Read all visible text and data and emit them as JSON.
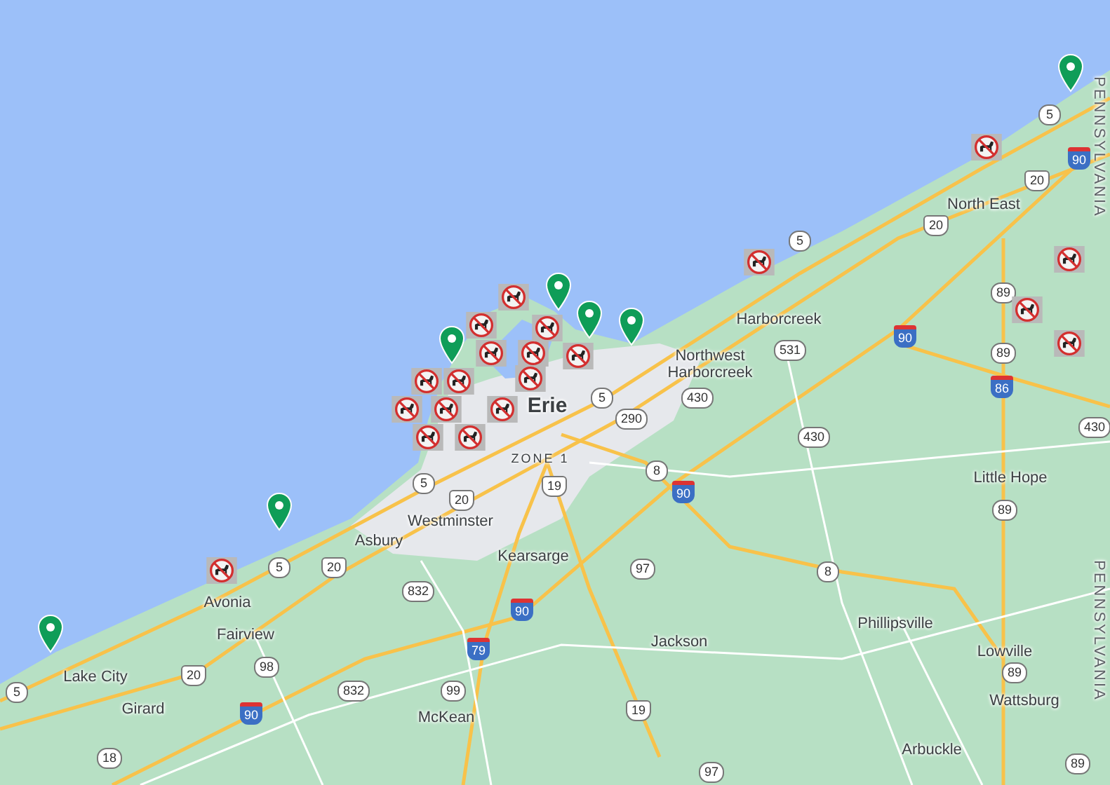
{
  "map": {
    "places": [
      {
        "label": "North East",
        "kind": "town"
      },
      {
        "label": "Harborcreek",
        "kind": "town"
      },
      {
        "label": "Northwest Harborcreek",
        "kind": "town"
      },
      {
        "label": "Erie",
        "kind": "city"
      },
      {
        "label": "ZONE 1",
        "kind": "district"
      },
      {
        "label": "Little Hope",
        "kind": "town"
      },
      {
        "label": "Westminster",
        "kind": "town"
      },
      {
        "label": "Asbury",
        "kind": "town"
      },
      {
        "label": "Kearsarge",
        "kind": "town"
      },
      {
        "label": "Avonia",
        "kind": "town"
      },
      {
        "label": "Fairview",
        "kind": "town"
      },
      {
        "label": "Jackson",
        "kind": "town"
      },
      {
        "label": "Phillipsville",
        "kind": "town"
      },
      {
        "label": "Lowville",
        "kind": "town"
      },
      {
        "label": "Lake City",
        "kind": "town"
      },
      {
        "label": "Girard",
        "kind": "town"
      },
      {
        "label": "Wattsburg",
        "kind": "town"
      },
      {
        "label": "McKean",
        "kind": "town"
      },
      {
        "label": "Arbuckle",
        "kind": "town"
      },
      {
        "label": "PENNSYLVANIA",
        "kind": "state"
      },
      {
        "label": "PENNSYLVANIA",
        "kind": "state"
      }
    ],
    "shields": [
      {
        "number": "5",
        "kind": "state"
      },
      {
        "number": "90",
        "kind": "interstate"
      },
      {
        "number": "20",
        "kind": "us"
      },
      {
        "number": "5",
        "kind": "state"
      },
      {
        "number": "20",
        "kind": "us"
      },
      {
        "number": "89",
        "kind": "state"
      },
      {
        "number": "531",
        "kind": "state"
      },
      {
        "number": "90",
        "kind": "interstate"
      },
      {
        "number": "89",
        "kind": "state"
      },
      {
        "number": "5",
        "kind": "state"
      },
      {
        "number": "430",
        "kind": "state"
      },
      {
        "number": "86",
        "kind": "interstate"
      },
      {
        "number": "290",
        "kind": "state"
      },
      {
        "number": "430",
        "kind": "state"
      },
      {
        "number": "430",
        "kind": "state"
      },
      {
        "number": "8",
        "kind": "state"
      },
      {
        "number": "5",
        "kind": "state"
      },
      {
        "number": "20",
        "kind": "us"
      },
      {
        "number": "19",
        "kind": "us"
      },
      {
        "number": "90",
        "kind": "interstate"
      },
      {
        "number": "89",
        "kind": "state"
      },
      {
        "number": "5",
        "kind": "state"
      },
      {
        "number": "20",
        "kind": "us"
      },
      {
        "number": "97",
        "kind": "state"
      },
      {
        "number": "8",
        "kind": "state"
      },
      {
        "number": "832",
        "kind": "state"
      },
      {
        "number": "90",
        "kind": "interstate"
      },
      {
        "number": "79",
        "kind": "interstate"
      },
      {
        "number": "20",
        "kind": "us"
      },
      {
        "number": "98",
        "kind": "state"
      },
      {
        "number": "89",
        "kind": "state"
      },
      {
        "number": "5",
        "kind": "state"
      },
      {
        "number": "832",
        "kind": "state"
      },
      {
        "number": "99",
        "kind": "state"
      },
      {
        "number": "90",
        "kind": "interstate"
      },
      {
        "number": "19",
        "kind": "us"
      },
      {
        "number": "18",
        "kind": "state"
      },
      {
        "number": "97",
        "kind": "state"
      },
      {
        "number": "89",
        "kind": "state"
      }
    ],
    "markers": [
      {
        "kind": "no-dogs"
      },
      {
        "kind": "no-dogs"
      },
      {
        "kind": "no-dogs"
      },
      {
        "kind": "no-dogs"
      },
      {
        "kind": "no-dogs"
      },
      {
        "kind": "no-dogs"
      },
      {
        "kind": "no-dogs"
      },
      {
        "kind": "no-dogs"
      },
      {
        "kind": "no-dogs"
      },
      {
        "kind": "no-dogs"
      },
      {
        "kind": "no-dogs"
      },
      {
        "kind": "no-dogs"
      },
      {
        "kind": "no-dogs"
      },
      {
        "kind": "no-dogs"
      },
      {
        "kind": "no-dogs"
      },
      {
        "kind": "no-dogs"
      },
      {
        "kind": "no-dogs"
      },
      {
        "kind": "no-dogs"
      },
      {
        "kind": "no-dogs"
      },
      {
        "kind": "no-dogs"
      },
      {
        "kind": "pin"
      },
      {
        "kind": "pin"
      },
      {
        "kind": "pin"
      },
      {
        "kind": "pin"
      },
      {
        "kind": "pin"
      },
      {
        "kind": "pin"
      },
      {
        "kind": "pin"
      }
    ]
  }
}
